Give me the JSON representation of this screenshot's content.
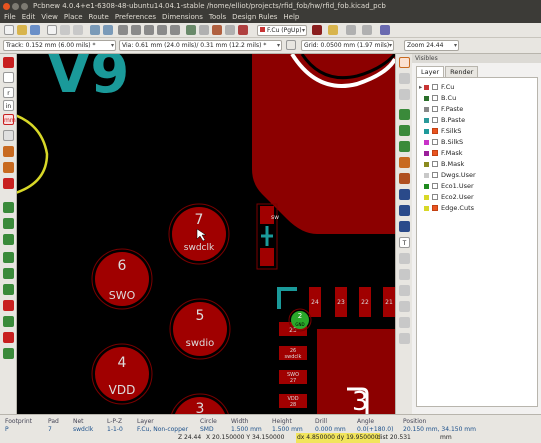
{
  "window": {
    "title": "Pcbnew 4.0.4+e1-6308-48-ubuntu14.04.1-stable /home/elliot/projects/rfid_fob/hw/rfid_fob.kicad_pcb"
  },
  "menu": [
    "File",
    "Edit",
    "View",
    "Place",
    "Route",
    "Preferences",
    "Dimensions",
    "Tools",
    "Design Rules",
    "Help"
  ],
  "toolbar": {
    "layer_select": "F.Cu (PgUp)",
    "track": "Track: 0.152 mm (6.00 mils) *",
    "via": "Via: 0.61 mm (24.0 mils)/ 0.31 mm (12.2 mils) *",
    "grid": "Grid: 0.0500 mm (1.97 mils)",
    "zoom": "Zoom 24.44"
  },
  "canvas": {
    "silk_label": "V9",
    "pads": [
      {
        "num": "7",
        "net": "swdclk"
      },
      {
        "num": "6",
        "net": "SWO"
      },
      {
        "num": "5",
        "net": "swdio"
      },
      {
        "num": "4",
        "net": "VDD"
      },
      {
        "num": "3",
        "net": ""
      }
    ],
    "small_pads": [
      "24",
      "23",
      "22",
      "21"
    ],
    "qfn_pads": [
      "25",
      "26",
      "27",
      "28"
    ],
    "qfn_netlabels": [
      "GND",
      "swdclk",
      "SWO",
      "VDD"
    ],
    "via_label": "2",
    "small_part_net": "sw",
    "corner_digit": "3"
  },
  "layers_panel": {
    "header": "Visibles",
    "tabs": [
      "Layer",
      "Render"
    ],
    "layers": [
      {
        "name": "F.Cu",
        "color": "#c83434",
        "checked": false,
        "selected": true
      },
      {
        "name": "B.Cu",
        "color": "#2a6f2a",
        "checked": false,
        "selected": false
      },
      {
        "name": "F.Paste",
        "color": "#888888",
        "checked": false,
        "selected": false
      },
      {
        "name": "B.Paste",
        "color": "#2a9a9a",
        "checked": false,
        "selected": false
      },
      {
        "name": "F.SilkS",
        "color": "#1e9a9a",
        "checked": true,
        "selected": false
      },
      {
        "name": "B.SilkS",
        "color": "#c832c8",
        "checked": false,
        "selected": false
      },
      {
        "name": "F.Mask",
        "color": "#9a1e9a",
        "checked": true,
        "selected": false
      },
      {
        "name": "B.Mask",
        "color": "#8a8a1e",
        "checked": false,
        "selected": false
      },
      {
        "name": "Dwgs.User",
        "color": "#c8c8c8",
        "checked": false,
        "selected": false
      },
      {
        "name": "Eco1.User",
        "color": "#1e8a1e",
        "checked": false,
        "selected": false
      },
      {
        "name": "Eco2.User",
        "color": "#d8d828",
        "checked": false,
        "selected": false
      },
      {
        "name": "Edge.Cuts",
        "color": "#d8d828",
        "checked": true,
        "selected": false
      }
    ]
  },
  "status": {
    "footprint": {
      "label": "Footprint",
      "value": "P"
    },
    "pad": {
      "label": "Pad",
      "value": "7"
    },
    "net": {
      "label": "Net",
      "value": "swdclk"
    },
    "lpz": {
      "label": "L-P-Z",
      "value": "1-1-0"
    },
    "layer": {
      "label": "Layer",
      "value": "F.Cu, Non-copper"
    },
    "circle": {
      "label": "Circle",
      "value": "SMD"
    },
    "width": {
      "label": "Width",
      "value": "1.500 mm"
    },
    "height": {
      "label": "Height",
      "value": "1.500 mm"
    },
    "drill": {
      "label": "Drill",
      "value": "0.000 mm"
    },
    "angle": {
      "label": "Angle",
      "value": "0.0(+180.0)"
    },
    "position": {
      "label": "Position",
      "value": "20.150 mm, 34.150 mm"
    }
  },
  "coords": {
    "z": "Z 24.44",
    "xy": "X 20.150000  Y 34.150000",
    "dxdy": "dx 4.850000  dy 19.950000",
    "dist": "dist 20.531",
    "units": "mm"
  },
  "colors": {
    "pad_red": "#a00000",
    "silk_cyan": "#1a9a9a",
    "edge_yellow": "#d8d828",
    "bg": "#000000"
  }
}
